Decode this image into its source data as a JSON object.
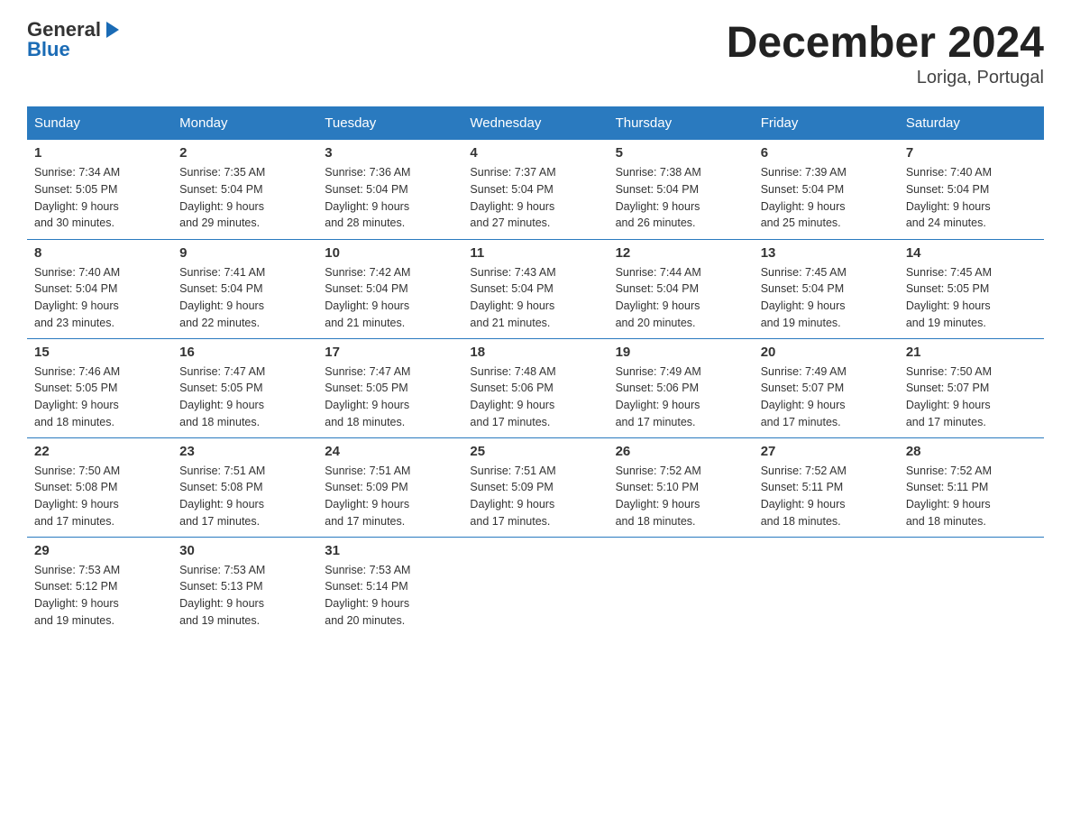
{
  "logo": {
    "general": "General",
    "arrow": "▶",
    "blue": "Blue"
  },
  "header": {
    "title": "December 2024",
    "location": "Loriga, Portugal"
  },
  "days_of_week": [
    "Sunday",
    "Monday",
    "Tuesday",
    "Wednesday",
    "Thursday",
    "Friday",
    "Saturday"
  ],
  "weeks": [
    [
      {
        "day": "1",
        "sunrise": "7:34 AM",
        "sunset": "5:05 PM",
        "daylight": "9 hours and 30 minutes."
      },
      {
        "day": "2",
        "sunrise": "7:35 AM",
        "sunset": "5:04 PM",
        "daylight": "9 hours and 29 minutes."
      },
      {
        "day": "3",
        "sunrise": "7:36 AM",
        "sunset": "5:04 PM",
        "daylight": "9 hours and 28 minutes."
      },
      {
        "day": "4",
        "sunrise": "7:37 AM",
        "sunset": "5:04 PM",
        "daylight": "9 hours and 27 minutes."
      },
      {
        "day": "5",
        "sunrise": "7:38 AM",
        "sunset": "5:04 PM",
        "daylight": "9 hours and 26 minutes."
      },
      {
        "day": "6",
        "sunrise": "7:39 AM",
        "sunset": "5:04 PM",
        "daylight": "9 hours and 25 minutes."
      },
      {
        "day": "7",
        "sunrise": "7:40 AM",
        "sunset": "5:04 PM",
        "daylight": "9 hours and 24 minutes."
      }
    ],
    [
      {
        "day": "8",
        "sunrise": "7:40 AM",
        "sunset": "5:04 PM",
        "daylight": "9 hours and 23 minutes."
      },
      {
        "day": "9",
        "sunrise": "7:41 AM",
        "sunset": "5:04 PM",
        "daylight": "9 hours and 22 minutes."
      },
      {
        "day": "10",
        "sunrise": "7:42 AM",
        "sunset": "5:04 PM",
        "daylight": "9 hours and 21 minutes."
      },
      {
        "day": "11",
        "sunrise": "7:43 AM",
        "sunset": "5:04 PM",
        "daylight": "9 hours and 21 minutes."
      },
      {
        "day": "12",
        "sunrise": "7:44 AM",
        "sunset": "5:04 PM",
        "daylight": "9 hours and 20 minutes."
      },
      {
        "day": "13",
        "sunrise": "7:45 AM",
        "sunset": "5:04 PM",
        "daylight": "9 hours and 19 minutes."
      },
      {
        "day": "14",
        "sunrise": "7:45 AM",
        "sunset": "5:05 PM",
        "daylight": "9 hours and 19 minutes."
      }
    ],
    [
      {
        "day": "15",
        "sunrise": "7:46 AM",
        "sunset": "5:05 PM",
        "daylight": "9 hours and 18 minutes."
      },
      {
        "day": "16",
        "sunrise": "7:47 AM",
        "sunset": "5:05 PM",
        "daylight": "9 hours and 18 minutes."
      },
      {
        "day": "17",
        "sunrise": "7:47 AM",
        "sunset": "5:05 PM",
        "daylight": "9 hours and 18 minutes."
      },
      {
        "day": "18",
        "sunrise": "7:48 AM",
        "sunset": "5:06 PM",
        "daylight": "9 hours and 17 minutes."
      },
      {
        "day": "19",
        "sunrise": "7:49 AM",
        "sunset": "5:06 PM",
        "daylight": "9 hours and 17 minutes."
      },
      {
        "day": "20",
        "sunrise": "7:49 AM",
        "sunset": "5:07 PM",
        "daylight": "9 hours and 17 minutes."
      },
      {
        "day": "21",
        "sunrise": "7:50 AM",
        "sunset": "5:07 PM",
        "daylight": "9 hours and 17 minutes."
      }
    ],
    [
      {
        "day": "22",
        "sunrise": "7:50 AM",
        "sunset": "5:08 PM",
        "daylight": "9 hours and 17 minutes."
      },
      {
        "day": "23",
        "sunrise": "7:51 AM",
        "sunset": "5:08 PM",
        "daylight": "9 hours and 17 minutes."
      },
      {
        "day": "24",
        "sunrise": "7:51 AM",
        "sunset": "5:09 PM",
        "daylight": "9 hours and 17 minutes."
      },
      {
        "day": "25",
        "sunrise": "7:51 AM",
        "sunset": "5:09 PM",
        "daylight": "9 hours and 17 minutes."
      },
      {
        "day": "26",
        "sunrise": "7:52 AM",
        "sunset": "5:10 PM",
        "daylight": "9 hours and 18 minutes."
      },
      {
        "day": "27",
        "sunrise": "7:52 AM",
        "sunset": "5:11 PM",
        "daylight": "9 hours and 18 minutes."
      },
      {
        "day": "28",
        "sunrise": "7:52 AM",
        "sunset": "5:11 PM",
        "daylight": "9 hours and 18 minutes."
      }
    ],
    [
      {
        "day": "29",
        "sunrise": "7:53 AM",
        "sunset": "5:12 PM",
        "daylight": "9 hours and 19 minutes."
      },
      {
        "day": "30",
        "sunrise": "7:53 AM",
        "sunset": "5:13 PM",
        "daylight": "9 hours and 19 minutes."
      },
      {
        "day": "31",
        "sunrise": "7:53 AM",
        "sunset": "5:14 PM",
        "daylight": "9 hours and 20 minutes."
      },
      {
        "day": "",
        "sunrise": "",
        "sunset": "",
        "daylight": ""
      },
      {
        "day": "",
        "sunrise": "",
        "sunset": "",
        "daylight": ""
      },
      {
        "day": "",
        "sunrise": "",
        "sunset": "",
        "daylight": ""
      },
      {
        "day": "",
        "sunrise": "",
        "sunset": "",
        "daylight": ""
      }
    ]
  ],
  "labels": {
    "sunrise": "Sunrise:",
    "sunset": "Sunset:",
    "daylight": "Daylight:"
  }
}
